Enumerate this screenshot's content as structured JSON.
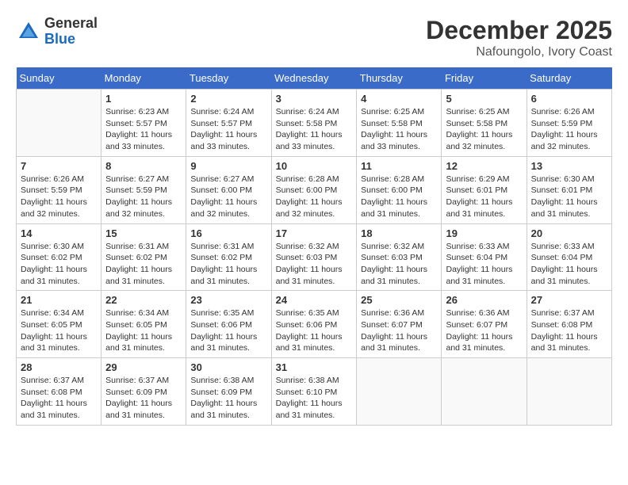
{
  "header": {
    "logo_general": "General",
    "logo_blue": "Blue",
    "month_year": "December 2025",
    "location": "Nafoungolo, Ivory Coast"
  },
  "days_of_week": [
    "Sunday",
    "Monday",
    "Tuesday",
    "Wednesday",
    "Thursday",
    "Friday",
    "Saturday"
  ],
  "weeks": [
    [
      {
        "day": "",
        "sunrise": "",
        "sunset": "",
        "daylight": ""
      },
      {
        "day": "1",
        "sunrise": "Sunrise: 6:23 AM",
        "sunset": "Sunset: 5:57 PM",
        "daylight": "Daylight: 11 hours and 33 minutes."
      },
      {
        "day": "2",
        "sunrise": "Sunrise: 6:24 AM",
        "sunset": "Sunset: 5:57 PM",
        "daylight": "Daylight: 11 hours and 33 minutes."
      },
      {
        "day": "3",
        "sunrise": "Sunrise: 6:24 AM",
        "sunset": "Sunset: 5:58 PM",
        "daylight": "Daylight: 11 hours and 33 minutes."
      },
      {
        "day": "4",
        "sunrise": "Sunrise: 6:25 AM",
        "sunset": "Sunset: 5:58 PM",
        "daylight": "Daylight: 11 hours and 33 minutes."
      },
      {
        "day": "5",
        "sunrise": "Sunrise: 6:25 AM",
        "sunset": "Sunset: 5:58 PM",
        "daylight": "Daylight: 11 hours and 32 minutes."
      },
      {
        "day": "6",
        "sunrise": "Sunrise: 6:26 AM",
        "sunset": "Sunset: 5:59 PM",
        "daylight": "Daylight: 11 hours and 32 minutes."
      }
    ],
    [
      {
        "day": "7",
        "sunrise": "Sunrise: 6:26 AM",
        "sunset": "Sunset: 5:59 PM",
        "daylight": "Daylight: 11 hours and 32 minutes."
      },
      {
        "day": "8",
        "sunrise": "Sunrise: 6:27 AM",
        "sunset": "Sunset: 5:59 PM",
        "daylight": "Daylight: 11 hours and 32 minutes."
      },
      {
        "day": "9",
        "sunrise": "Sunrise: 6:27 AM",
        "sunset": "Sunset: 6:00 PM",
        "daylight": "Daylight: 11 hours and 32 minutes."
      },
      {
        "day": "10",
        "sunrise": "Sunrise: 6:28 AM",
        "sunset": "Sunset: 6:00 PM",
        "daylight": "Daylight: 11 hours and 32 minutes."
      },
      {
        "day": "11",
        "sunrise": "Sunrise: 6:28 AM",
        "sunset": "Sunset: 6:00 PM",
        "daylight": "Daylight: 11 hours and 31 minutes."
      },
      {
        "day": "12",
        "sunrise": "Sunrise: 6:29 AM",
        "sunset": "Sunset: 6:01 PM",
        "daylight": "Daylight: 11 hours and 31 minutes."
      },
      {
        "day": "13",
        "sunrise": "Sunrise: 6:30 AM",
        "sunset": "Sunset: 6:01 PM",
        "daylight": "Daylight: 11 hours and 31 minutes."
      }
    ],
    [
      {
        "day": "14",
        "sunrise": "Sunrise: 6:30 AM",
        "sunset": "Sunset: 6:02 PM",
        "daylight": "Daylight: 11 hours and 31 minutes."
      },
      {
        "day": "15",
        "sunrise": "Sunrise: 6:31 AM",
        "sunset": "Sunset: 6:02 PM",
        "daylight": "Daylight: 11 hours and 31 minutes."
      },
      {
        "day": "16",
        "sunrise": "Sunrise: 6:31 AM",
        "sunset": "Sunset: 6:02 PM",
        "daylight": "Daylight: 11 hours and 31 minutes."
      },
      {
        "day": "17",
        "sunrise": "Sunrise: 6:32 AM",
        "sunset": "Sunset: 6:03 PM",
        "daylight": "Daylight: 11 hours and 31 minutes."
      },
      {
        "day": "18",
        "sunrise": "Sunrise: 6:32 AM",
        "sunset": "Sunset: 6:03 PM",
        "daylight": "Daylight: 11 hours and 31 minutes."
      },
      {
        "day": "19",
        "sunrise": "Sunrise: 6:33 AM",
        "sunset": "Sunset: 6:04 PM",
        "daylight": "Daylight: 11 hours and 31 minutes."
      },
      {
        "day": "20",
        "sunrise": "Sunrise: 6:33 AM",
        "sunset": "Sunset: 6:04 PM",
        "daylight": "Daylight: 11 hours and 31 minutes."
      }
    ],
    [
      {
        "day": "21",
        "sunrise": "Sunrise: 6:34 AM",
        "sunset": "Sunset: 6:05 PM",
        "daylight": "Daylight: 11 hours and 31 minutes."
      },
      {
        "day": "22",
        "sunrise": "Sunrise: 6:34 AM",
        "sunset": "Sunset: 6:05 PM",
        "daylight": "Daylight: 11 hours and 31 minutes."
      },
      {
        "day": "23",
        "sunrise": "Sunrise: 6:35 AM",
        "sunset": "Sunset: 6:06 PM",
        "daylight": "Daylight: 11 hours and 31 minutes."
      },
      {
        "day": "24",
        "sunrise": "Sunrise: 6:35 AM",
        "sunset": "Sunset: 6:06 PM",
        "daylight": "Daylight: 11 hours and 31 minutes."
      },
      {
        "day": "25",
        "sunrise": "Sunrise: 6:36 AM",
        "sunset": "Sunset: 6:07 PM",
        "daylight": "Daylight: 11 hours and 31 minutes."
      },
      {
        "day": "26",
        "sunrise": "Sunrise: 6:36 AM",
        "sunset": "Sunset: 6:07 PM",
        "daylight": "Daylight: 11 hours and 31 minutes."
      },
      {
        "day": "27",
        "sunrise": "Sunrise: 6:37 AM",
        "sunset": "Sunset: 6:08 PM",
        "daylight": "Daylight: 11 hours and 31 minutes."
      }
    ],
    [
      {
        "day": "28",
        "sunrise": "Sunrise: 6:37 AM",
        "sunset": "Sunset: 6:08 PM",
        "daylight": "Daylight: 11 hours and 31 minutes."
      },
      {
        "day": "29",
        "sunrise": "Sunrise: 6:37 AM",
        "sunset": "Sunset: 6:09 PM",
        "daylight": "Daylight: 11 hours and 31 minutes."
      },
      {
        "day": "30",
        "sunrise": "Sunrise: 6:38 AM",
        "sunset": "Sunset: 6:09 PM",
        "daylight": "Daylight: 11 hours and 31 minutes."
      },
      {
        "day": "31",
        "sunrise": "Sunrise: 6:38 AM",
        "sunset": "Sunset: 6:10 PM",
        "daylight": "Daylight: 11 hours and 31 minutes."
      },
      {
        "day": "",
        "sunrise": "",
        "sunset": "",
        "daylight": ""
      },
      {
        "day": "",
        "sunrise": "",
        "sunset": "",
        "daylight": ""
      },
      {
        "day": "",
        "sunrise": "",
        "sunset": "",
        "daylight": ""
      }
    ]
  ]
}
